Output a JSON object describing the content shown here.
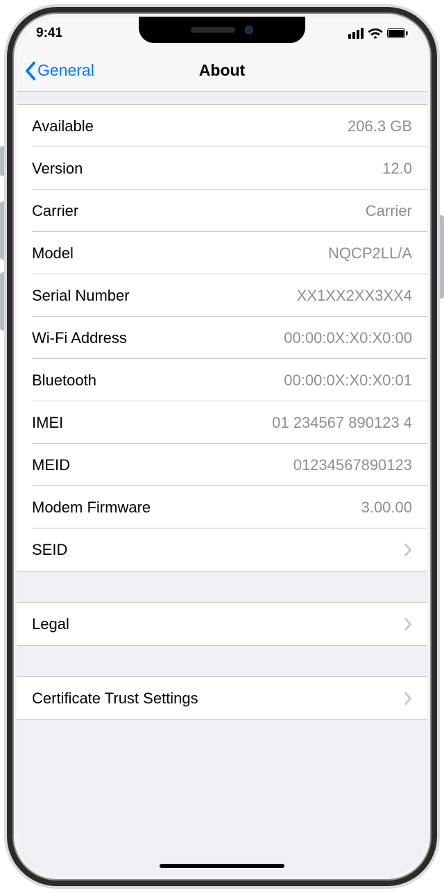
{
  "status": {
    "time": "9:41"
  },
  "nav": {
    "back_label": "General",
    "title": "About"
  },
  "rows": {
    "available": {
      "label": "Available",
      "value": "206.3 GB"
    },
    "version": {
      "label": "Version",
      "value": "12.0"
    },
    "carrier": {
      "label": "Carrier",
      "value": "Carrier"
    },
    "model": {
      "label": "Model",
      "value": "NQCP2LL/A"
    },
    "serial": {
      "label": "Serial Number",
      "value": "XX1XX2XX3XX4"
    },
    "wifi": {
      "label": "Wi-Fi Address",
      "value": "00:00:0X:X0:X0:00"
    },
    "bluetooth": {
      "label": "Bluetooth",
      "value": "00:00:0X:X0:X0:01"
    },
    "imei": {
      "label": "IMEI",
      "value": "01 234567 890123 4"
    },
    "meid": {
      "label": "MEID",
      "value": "01234567890123"
    },
    "modem": {
      "label": "Modem Firmware",
      "value": "3.00.00"
    },
    "seid": {
      "label": "SEID"
    },
    "legal": {
      "label": "Legal"
    },
    "cert": {
      "label": "Certificate Trust Settings"
    }
  }
}
